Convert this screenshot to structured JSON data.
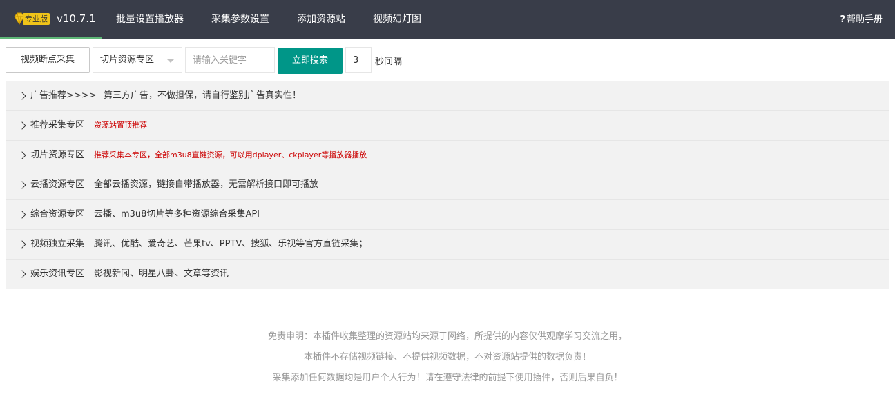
{
  "header": {
    "badge": "专业版",
    "version": "v10.7.1",
    "nav": [
      "批量设置播放器",
      "采集参数设置",
      "添加资源站",
      "视频幻灯图"
    ],
    "help_icon": "?",
    "help_label": "帮助手册"
  },
  "toolbar": {
    "resume_button": "视频断点采集",
    "category_select": "切片资源专区",
    "search_placeholder": "请输入关键字",
    "search_button": "立即搜索",
    "interval_value": "3",
    "interval_unit": "秒间隔"
  },
  "panels": [
    {
      "title": "广告推荐>>>>",
      "desc": "第三方广告，不做担保，请自行鉴别广告真实性！",
      "highlight": false
    },
    {
      "title": "推荐采集专区",
      "desc": "资源站置顶推荐",
      "highlight": true
    },
    {
      "title": "切片资源专区",
      "desc": "推荐采集本专区，全部m3u8直链资源，可以用dplayer、ckplayer等播放器播放",
      "highlight": true
    },
    {
      "title": "云播资源专区",
      "desc": "全部云播资源，链接自带播放器，无需解析接口即可播放",
      "highlight": false
    },
    {
      "title": "综合资源专区",
      "desc": "云播、m3u8切片等多种资源综合采集API",
      "highlight": false
    },
    {
      "title": "视频独立采集",
      "desc": "腾讯、优酷、爱奇艺、芒果tv、PPTV、搜狐、乐视等官方直链采集；",
      "highlight": false
    },
    {
      "title": "娱乐资讯专区",
      "desc": "影视新闻、明星八卦、文章等资讯",
      "highlight": false
    }
  ],
  "footer": {
    "line1": "免责申明：本插件收集整理的资源站均来源于网络，所提供的内容仅供观摩学习交流之用，",
    "line2": "本插件不存储视频链接、不提供视频数据，不对资源站提供的数据负责！",
    "line3": "采集添加任何数据均是用户个人行为！请在遵守法律的前提下使用插件，否则后果自负！"
  }
}
